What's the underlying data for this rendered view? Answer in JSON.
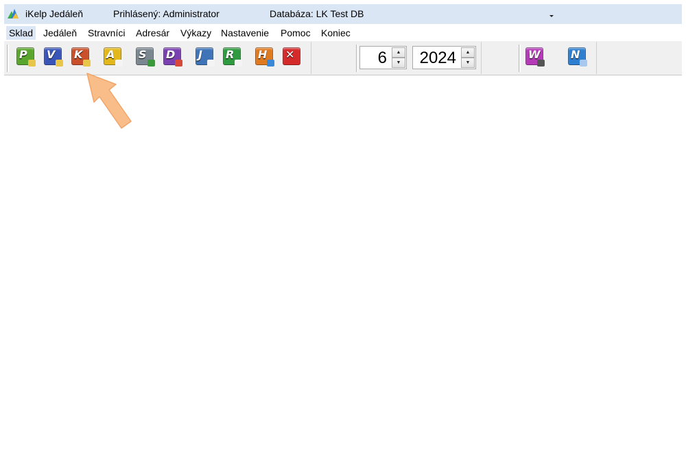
{
  "titlebar": {
    "app_name": "iKelp Jedáleň",
    "user": "Prihlásený: Administrator",
    "database": "Databáza: LK Test DB"
  },
  "menu": {
    "items": [
      {
        "label": "Sklad"
      },
      {
        "label": "Jedáleň"
      },
      {
        "label": "Stravníci"
      },
      {
        "label": "Adresár"
      },
      {
        "label": "Výkazy"
      },
      {
        "label": "Nastavenie"
      },
      {
        "label": "Pomoc"
      },
      {
        "label": "Koniec"
      }
    ]
  },
  "toolbar": {
    "buttons": [
      {
        "letter": "P",
        "color": "#5aa52d",
        "badge": "#e8c64a"
      },
      {
        "letter": "V",
        "color": "#3a55b8",
        "badge": "#e8c64a"
      },
      {
        "letter": "K",
        "color": "#c9502a",
        "badge": "#e8c64a"
      },
      {
        "letter": "A",
        "color": "#e3b81d",
        "badge": "#f4f4f4"
      },
      {
        "letter": "S",
        "color": "#7b8790",
        "badge": "#3a9a3a"
      },
      {
        "letter": "D",
        "color": "#7a3fb0",
        "badge": "#d8483a"
      },
      {
        "letter": "J",
        "color": "#3f74b8",
        "badge": "#f4f4f4"
      },
      {
        "letter": "R",
        "color": "#2f9a3f",
        "badge": "#f4f4f4"
      },
      {
        "letter": "H",
        "color": "#e07a20",
        "badge": "#3a88d8"
      },
      {
        "letter": "✕",
        "color": "#d42a2a",
        "badge": ""
      }
    ],
    "month": "6",
    "year": "2024",
    "extra_buttons": [
      {
        "letter": "W",
        "color": "#b43ab8",
        "badge": "#555555"
      },
      {
        "letter": "N",
        "color": "#2f7fd0",
        "badge": "#a8c8ef"
      }
    ]
  },
  "colors": {
    "titlebar": "#dbe6f5",
    "menu_highlight": "#dbe7f6",
    "hint_arrow": "#f9bd8a"
  }
}
